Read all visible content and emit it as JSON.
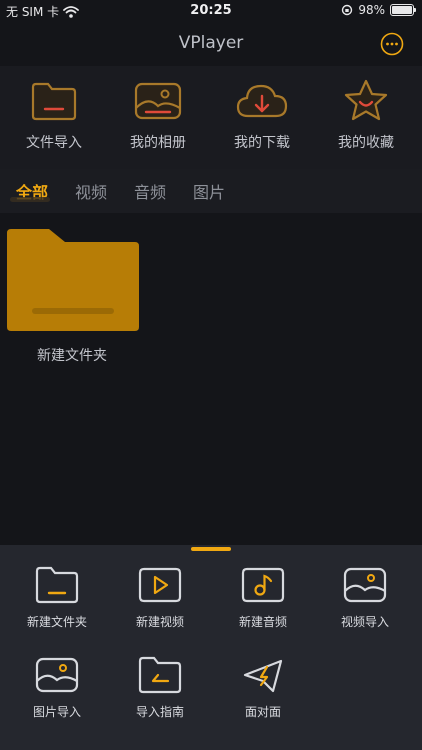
{
  "status_bar": {
    "carrier": "无 SIM 卡",
    "time": "20:25",
    "battery_text": "98%",
    "battery_level": 0.98
  },
  "nav": {
    "title": "VPlayer",
    "more_icon": "ellipsis-circle-icon"
  },
  "quick_actions": [
    {
      "label": "文件导入",
      "icon": "folder-icon"
    },
    {
      "label": "我的相册",
      "icon": "photo-album-icon"
    },
    {
      "label": "我的下载",
      "icon": "cloud-download-icon"
    },
    {
      "label": "我的收藏",
      "icon": "star-icon"
    }
  ],
  "tabs": [
    {
      "label": "全部",
      "active": true
    },
    {
      "label": "视频",
      "active": false
    },
    {
      "label": "音频",
      "active": false
    },
    {
      "label": "图片",
      "active": false
    }
  ],
  "items": [
    {
      "label": "新建文件夹",
      "icon": "folder-icon"
    }
  ],
  "action_sheet": [
    {
      "label": "新建文件夹",
      "icon": "folder-icon"
    },
    {
      "label": "新建视频",
      "icon": "play-icon"
    },
    {
      "label": "新建音频",
      "icon": "music-note-icon"
    },
    {
      "label": "视频导入",
      "icon": "video-import-icon"
    },
    {
      "label": "图片导入",
      "icon": "image-import-icon"
    },
    {
      "label": "导入指南",
      "icon": "guide-folder-icon"
    },
    {
      "label": "面对面",
      "icon": "paper-plane-icon"
    }
  ],
  "colors": {
    "accent": "#f0a812",
    "folder": "#b77d06",
    "background": "#141519",
    "sheet": "#25272e",
    "icon_stroke": "#d7d9de"
  }
}
